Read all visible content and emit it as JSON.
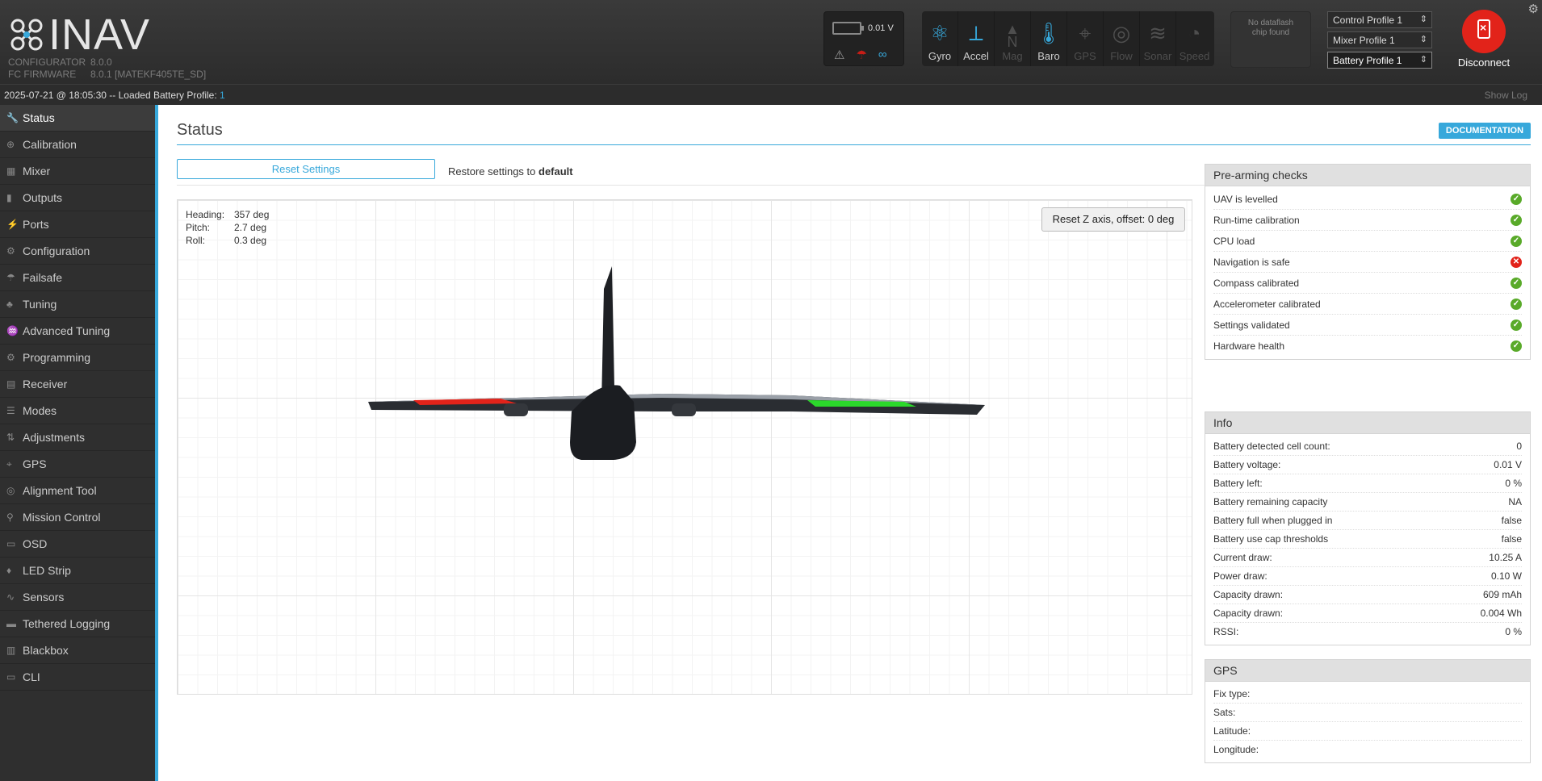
{
  "header": {
    "logo_text": "INAV",
    "versions": [
      {
        "label": "CONFIGURATOR",
        "value": "8.0.0"
      },
      {
        "label": "FC FIRMWARE",
        "value": "8.0.1 [MATEKF405TE_SD]"
      }
    ],
    "battery_voltage": "0.01 V",
    "sensors": [
      {
        "label": "Gyro",
        "icon": "gyro-icon",
        "active": true
      },
      {
        "label": "Accel",
        "icon": "accel-icon",
        "active": true
      },
      {
        "label": "Mag",
        "icon": "mag-icon",
        "active": false
      },
      {
        "label": "Baro",
        "icon": "baro-icon",
        "active": true
      },
      {
        "label": "GPS",
        "icon": "gps-icon",
        "active": false
      },
      {
        "label": "Flow",
        "icon": "flow-icon",
        "active": false
      },
      {
        "label": "Sonar",
        "icon": "sonar-icon",
        "active": false
      },
      {
        "label": "Speed",
        "icon": "speed-icon",
        "active": false
      }
    ],
    "dataflash": "No dataflash chip found",
    "profiles": [
      "Control Profile 1",
      "Mixer Profile 1",
      "Battery Profile 1"
    ],
    "disconnect_label": "Disconnect",
    "mag_letter": "N"
  },
  "logbar": {
    "message": "2025-07-21 @ 18:05:30 -- Loaded Battery Profile: ",
    "profile_number": "1",
    "show_log": "Show Log"
  },
  "sidebar": {
    "items": [
      {
        "label": "Status",
        "icon": "wrench-icon"
      },
      {
        "label": "Calibration",
        "icon": "calibration-icon"
      },
      {
        "label": "Mixer",
        "icon": "mixer-icon"
      },
      {
        "label": "Outputs",
        "icon": "outputs-icon"
      },
      {
        "label": "Ports",
        "icon": "ports-icon"
      },
      {
        "label": "Configuration",
        "icon": "gear-icon"
      },
      {
        "label": "Failsafe",
        "icon": "parachute-icon"
      },
      {
        "label": "Tuning",
        "icon": "tuning-icon"
      },
      {
        "label": "Advanced Tuning",
        "icon": "advanced-tuning-icon"
      },
      {
        "label": "Programming",
        "icon": "programming-icon"
      },
      {
        "label": "Receiver",
        "icon": "receiver-icon"
      },
      {
        "label": "Modes",
        "icon": "modes-icon"
      },
      {
        "label": "Adjustments",
        "icon": "sliders-icon"
      },
      {
        "label": "GPS",
        "icon": "satellite-icon"
      },
      {
        "label": "Alignment Tool",
        "icon": "alignment-icon"
      },
      {
        "label": "Mission Control",
        "icon": "map-pin-icon"
      },
      {
        "label": "OSD",
        "icon": "osd-icon"
      },
      {
        "label": "LED Strip",
        "icon": "led-icon"
      },
      {
        "label": "Sensors",
        "icon": "sensors-icon"
      },
      {
        "label": "Tethered Logging",
        "icon": "tethered-logging-icon"
      },
      {
        "label": "Blackbox",
        "icon": "blackbox-icon"
      },
      {
        "label": "CLI",
        "icon": "terminal-icon"
      }
    ],
    "active_index": 0
  },
  "main": {
    "title": "Status",
    "documentation_label": "DOCUMENTATION",
    "reset_settings_label": "Reset Settings",
    "restore_text": "Restore settings to ",
    "restore_bold": "default",
    "attitude": [
      {
        "label": "Heading:",
        "value": "357 deg"
      },
      {
        "label": "Pitch:",
        "value": "2.7 deg"
      },
      {
        "label": "Roll:",
        "value": "0.3 deg"
      }
    ],
    "reset_z_label": "Reset Z axis, offset: 0 deg"
  },
  "prearming": {
    "title": "Pre-arming checks",
    "checks": [
      {
        "label": "UAV is levelled",
        "ok": true
      },
      {
        "label": "Run-time calibration",
        "ok": true
      },
      {
        "label": "CPU load",
        "ok": true
      },
      {
        "label": "Navigation is safe",
        "ok": false
      },
      {
        "label": "Compass calibrated",
        "ok": true
      },
      {
        "label": "Accelerometer calibrated",
        "ok": true
      },
      {
        "label": "Settings validated",
        "ok": true
      },
      {
        "label": "Hardware health",
        "ok": true
      }
    ]
  },
  "info": {
    "title": "Info",
    "rows": [
      {
        "label": "Battery detected cell count:",
        "value": "0"
      },
      {
        "label": "Battery voltage:",
        "value": "0.01 V"
      },
      {
        "label": "Battery left:",
        "value": "0 %"
      },
      {
        "label": "Battery remaining capacity",
        "value": "NA"
      },
      {
        "label": "Battery full when plugged in",
        "value": "false"
      },
      {
        "label": "Battery use cap thresholds",
        "value": "false"
      },
      {
        "label": "Current draw:",
        "value": "10.25 A"
      },
      {
        "label": "Power draw:",
        "value": "0.10 W"
      },
      {
        "label": "Capacity drawn:",
        "value": "609 mAh"
      },
      {
        "label": "Capacity drawn:",
        "value": "0.004 Wh"
      },
      {
        "label": "RSSI:",
        "value": "0 %"
      }
    ]
  },
  "gps": {
    "title": "GPS",
    "rows": [
      {
        "label": "Fix type:",
        "value": ""
      },
      {
        "label": "Sats:",
        "value": ""
      },
      {
        "label": "Latitude:",
        "value": ""
      },
      {
        "label": "Longitude:",
        "value": ""
      }
    ]
  },
  "colors": {
    "accent": "#37a8db",
    "ok": "#59aa29",
    "error": "#e2231a"
  }
}
